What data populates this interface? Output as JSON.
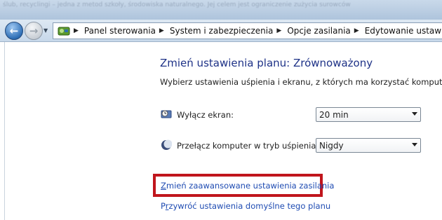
{
  "background_text": "ślub, recyclingi – jedna z metod szkoły, środowiska naturalnego. Jej celem jest ograniczenie zużycia surowców",
  "navigation": {
    "back_icon": "back-arrow-icon",
    "forward_icon": "forward-arrow-icon",
    "dropdown_icon": "chevron-down-icon"
  },
  "address_bar": {
    "icon": "control-panel-icon",
    "crumbs": [
      "Panel sterowania",
      "System i zabezpieczenia",
      "Opcje zasilania",
      "Edytowanie ustawień planu"
    ]
  },
  "main": {
    "title": "Zmień ustawienia planu: Zrównoważony",
    "subtitle": "Wybierz ustawienia uśpienia i ekranu, z których ma korzystać komputer.",
    "display_label": "Wyłącz ekran:",
    "display_value": "20 min",
    "sleep_label": "Przełącz komputer w tryb uśpienia:",
    "sleep_value": "Nigdy",
    "link_advanced_first": "Z",
    "link_advanced_rest": "mień zaawansowane ustawienia zasilania",
    "link_restore_first": "P",
    "link_restore_underlined": "r",
    "link_restore_rest": "zywróć ustawienia domyślne tego planu"
  },
  "colors": {
    "title": "#1e3287",
    "link": "#1e4bb2",
    "highlight": "#c0151c"
  }
}
